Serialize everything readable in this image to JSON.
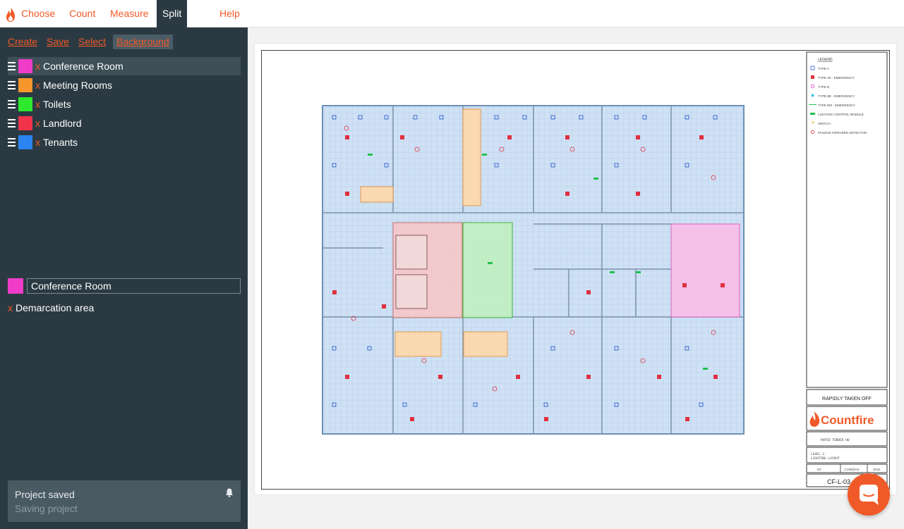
{
  "nav": {
    "items": [
      {
        "label": "Choose"
      },
      {
        "label": "Count"
      },
      {
        "label": "Measure"
      },
      {
        "label": "Split"
      },
      {
        "label": "Help"
      }
    ]
  },
  "toolbar": {
    "create": "Create",
    "save": "Save",
    "select": "Select",
    "background": "Background"
  },
  "layers": [
    {
      "name": "Conference Room",
      "color": "#f03cc8",
      "delete": "x"
    },
    {
      "name": "Meeting Rooms",
      "color": "#f7962d",
      "delete": "x"
    },
    {
      "name": "Toilets",
      "color": "#2ee82e",
      "delete": "x"
    },
    {
      "name": "Landlord",
      "color": "#f0334a",
      "delete": "x"
    },
    {
      "name": "Tenants",
      "color": "#2a85f0",
      "delete": "x"
    }
  ],
  "editor": {
    "name_value": "Conference Room",
    "swatch_color": "#f03cc8",
    "demarcation_delete": "x",
    "demarcation_label": "Demarcation area"
  },
  "notification": {
    "title": "Project saved",
    "subtitle": "Saving project"
  },
  "drawing": {
    "legend_title": "LEGEND",
    "legend_items": [
      "TYPE A",
      "TYPE AE - EMERGENCY",
      "TYPE B",
      "TYPE BE - EMERGENCY",
      "TYPE DM - EMERGENCY",
      "LIGHTING CONTROL MODULE",
      "SWITCH",
      "PASSIVE INFRARED DETECTOR"
    ],
    "drawing_status": "RAPIDLY TAKEN OFF",
    "brand": "Countfire",
    "project": "RAPID TENDER HQ",
    "title_line1": "LEVEL 3",
    "title_line2": "LIGHTING LAYOUT",
    "drawn": "NT",
    "scale": "1:100@A3",
    "date": "2016",
    "drawing_number": "CF-L-03"
  },
  "colors": {
    "accent": "#f05a28",
    "sidebar": "#2b3a42"
  }
}
